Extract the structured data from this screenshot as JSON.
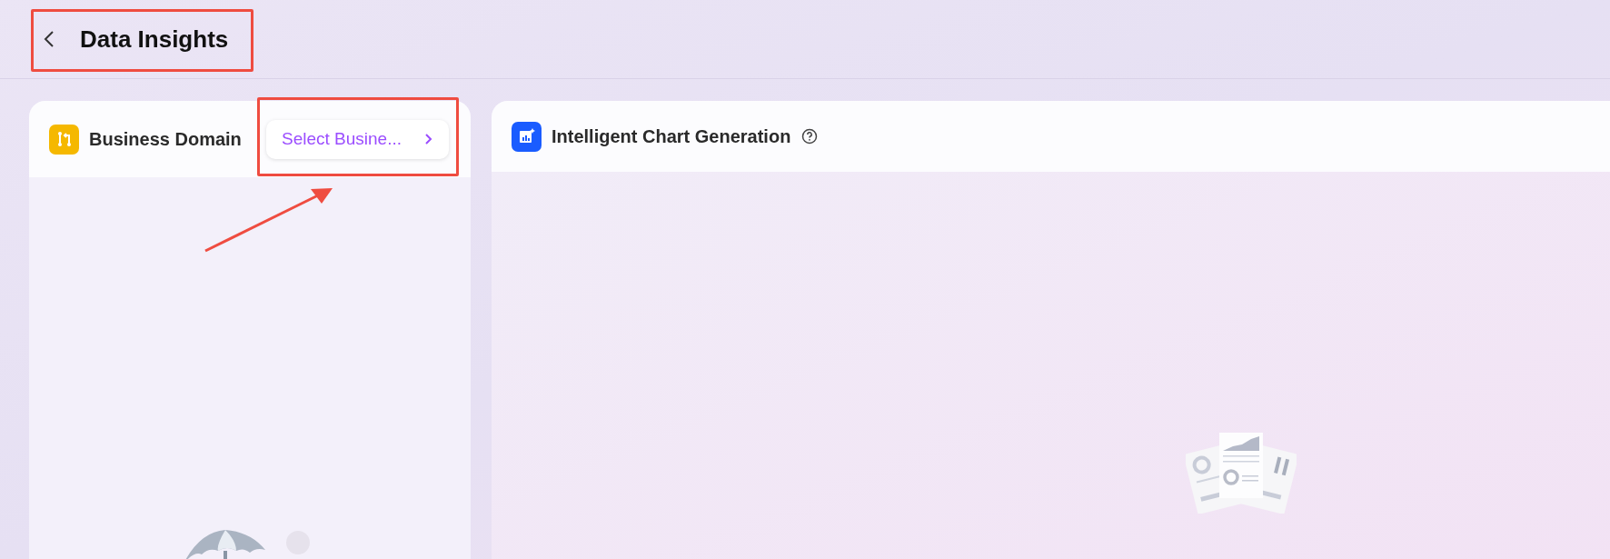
{
  "header": {
    "title": "Data Insights"
  },
  "business_domain": {
    "title": "Business Domain",
    "select_button": "Select Busine..."
  },
  "chart_generation": {
    "title": "Intelligent Chart Generation"
  }
}
